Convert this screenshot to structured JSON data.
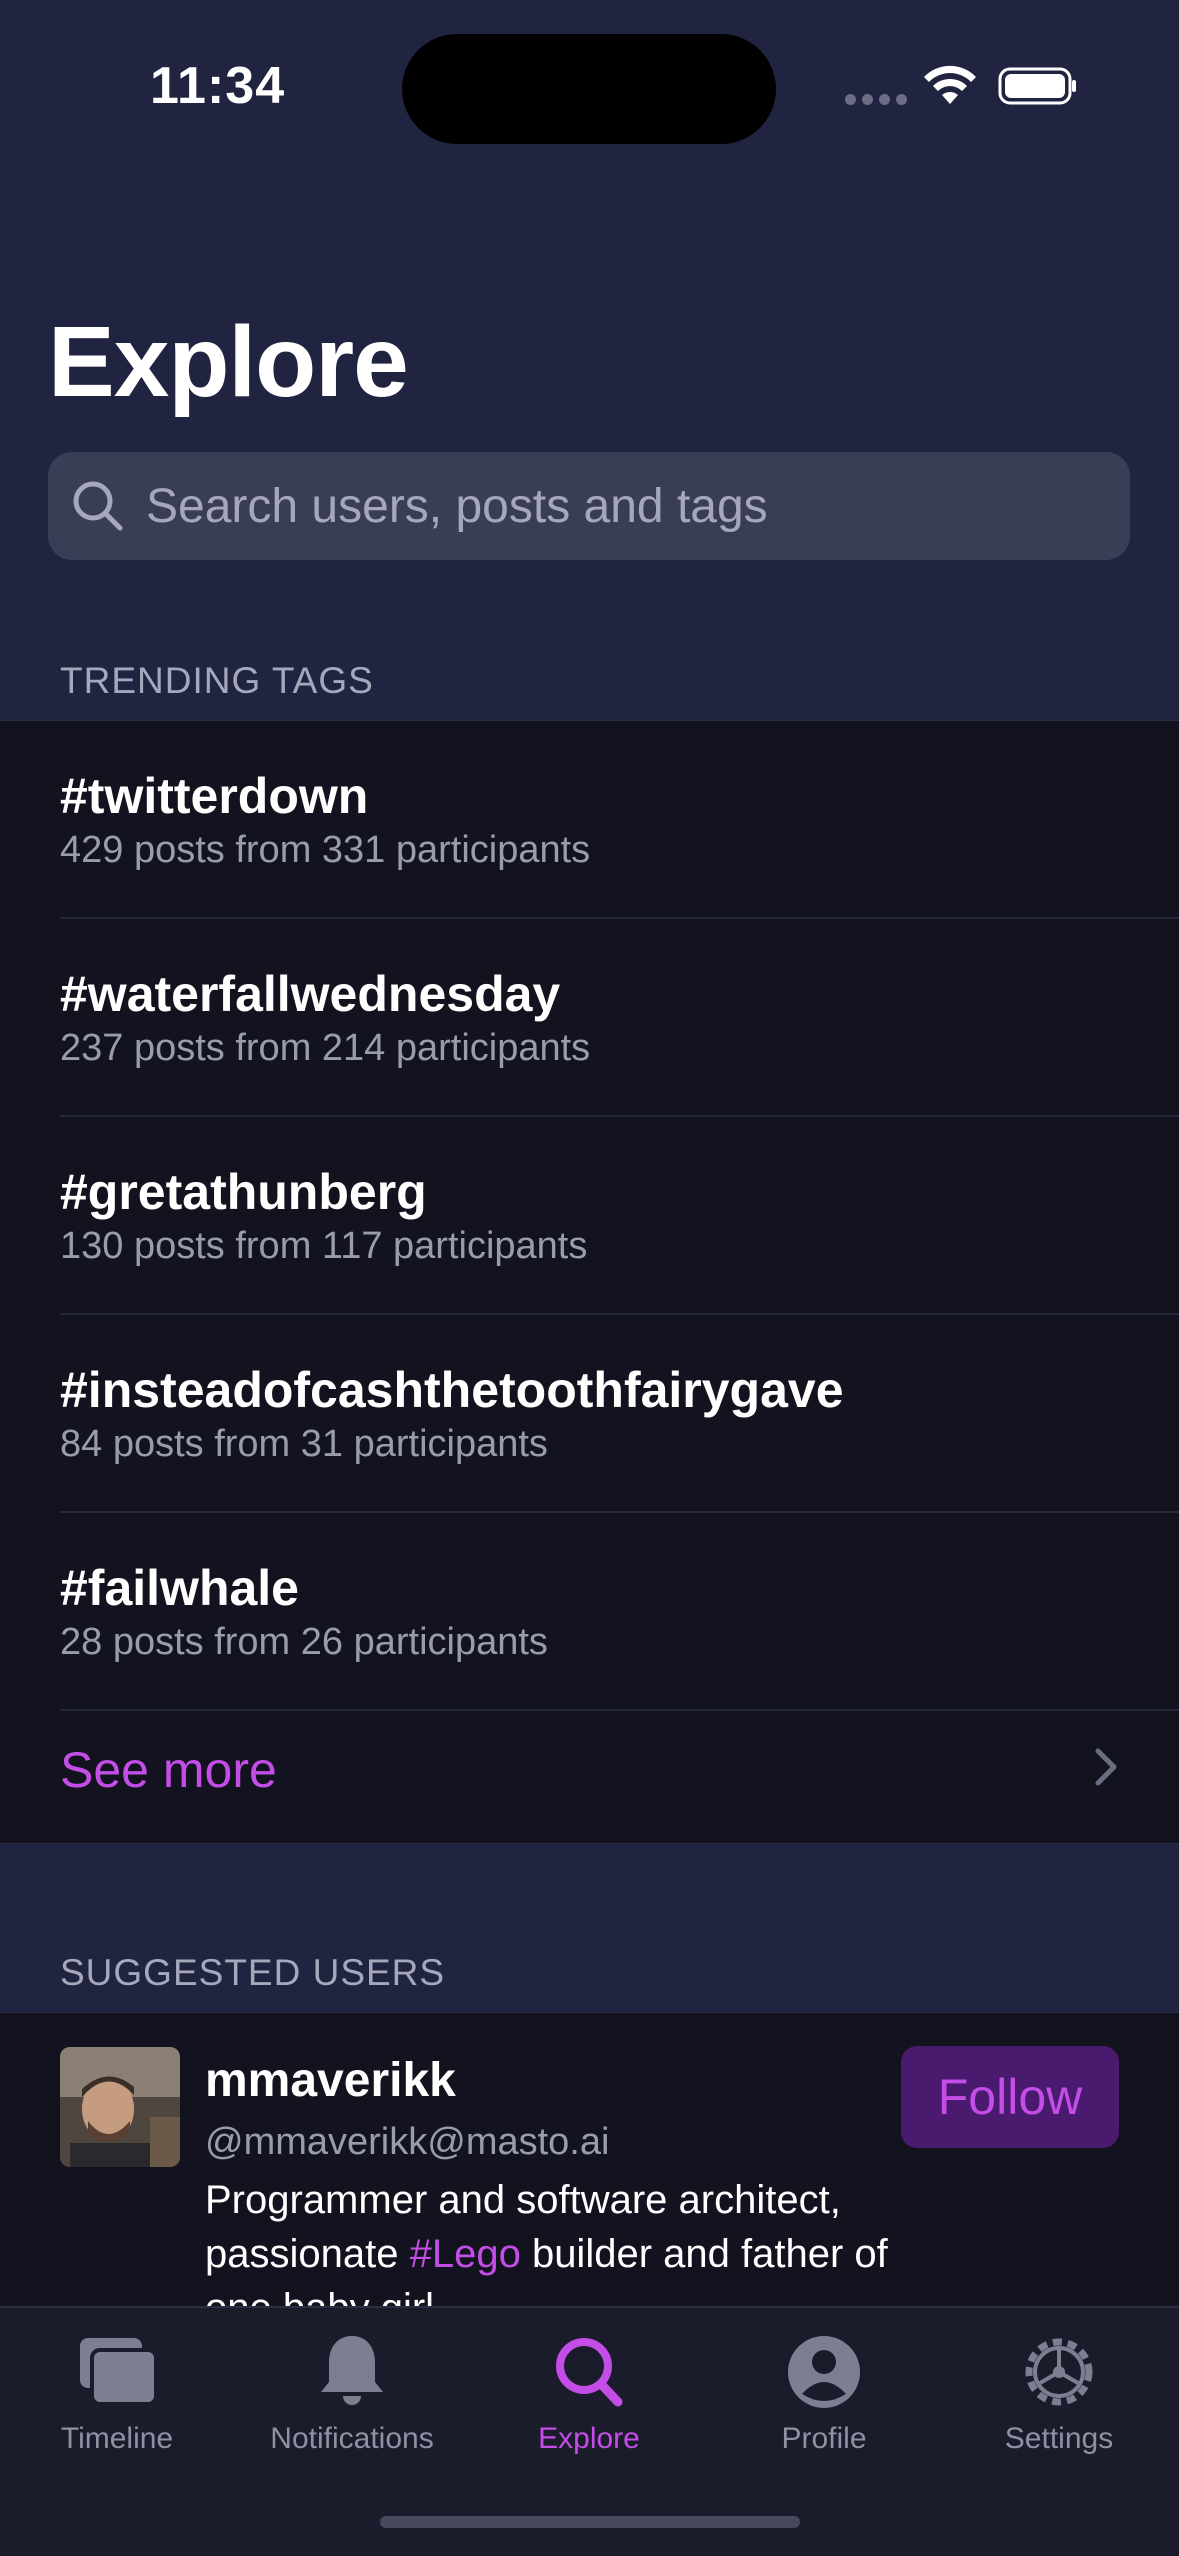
{
  "status_bar": {
    "time": "11:34"
  },
  "page": {
    "title": "Explore"
  },
  "search": {
    "placeholder": "Search users, posts and tags"
  },
  "trending": {
    "header": "TRENDING TAGS",
    "tags": [
      {
        "name": "#twitterdown",
        "stats": "429 posts from 331 participants"
      },
      {
        "name": "#waterfallwednesday",
        "stats": "237 posts from 214 participants"
      },
      {
        "name": "#gretathunberg",
        "stats": "130 posts from 117 participants"
      },
      {
        "name": "#insteadofcashthetoothfairygave",
        "stats": "84 posts from 31 participants"
      },
      {
        "name": "#failwhale",
        "stats": "28 posts from 26 participants"
      }
    ],
    "see_more": "See more"
  },
  "suggested": {
    "header": "SUGGESTED USERS",
    "user": {
      "name": "mmaverikk",
      "handle": "@mmaverikk@masto.ai",
      "bio_before": "Programmer and software architect, passionate ",
      "bio_tag": "#Lego",
      "bio_after": " builder and father of one baby girl.",
      "follow_label": "Follow"
    }
  },
  "tabs": [
    {
      "label": "Timeline",
      "icon": "timeline-icon",
      "active": false
    },
    {
      "label": "Notifications",
      "icon": "bell-icon",
      "active": false
    },
    {
      "label": "Explore",
      "icon": "search-icon",
      "active": true
    },
    {
      "label": "Profile",
      "icon": "person-circle-icon",
      "active": false
    },
    {
      "label": "Settings",
      "icon": "gear-icon",
      "active": false
    }
  ],
  "colors": {
    "background": "#212440",
    "panel": "#12131f",
    "accent": "#c44de8",
    "secondary_text": "#9a9cae",
    "follow_button_bg": "#4a1a6e"
  }
}
